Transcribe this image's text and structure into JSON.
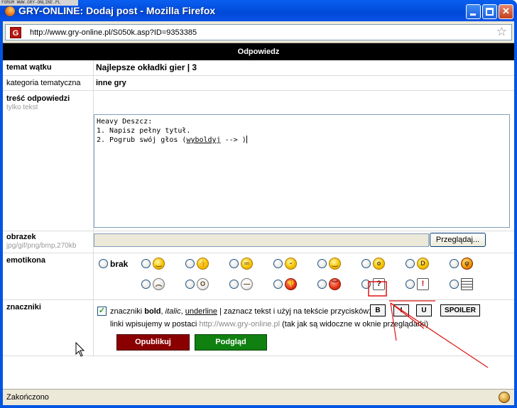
{
  "watermark": "FORUM WWW.GRY-ONLINE.PL",
  "window": {
    "title": "GRY-ONLINE: Dodaj post - Mozilla Firefox",
    "minimize_icon": "minimize-icon",
    "maximize_icon": "maximize-icon",
    "close_icon": "close-icon"
  },
  "address": {
    "site_icon_letter": "G",
    "url": "http://www.gry-online.pl/S050k.asp?ID=9353385"
  },
  "form": {
    "header": "Odpowiedz",
    "topic_label": "temat wątku",
    "topic_value": "Najlepsze okładki gier | 3",
    "category_label": "kategoria tematyczna",
    "category_value": "inne gry",
    "content_label": "treść odpowiedzi",
    "content_sublabel": "tylko tekst",
    "content_value_line1": "Heavy Deszcz:",
    "content_value_line2": "1. Napisz pełny tytuł.",
    "content_value_line3_prefix": "2. Pogrub swój głos (",
    "content_value_line3_link": "wyboldyj",
    "content_value_line3_suffix": " --> )",
    "image_label": "obrazek",
    "image_sublabel": "jpg/gif/png/bmp,270kb",
    "browse_button": "Przeglądaj...",
    "emoticons_label": "emotikona",
    "emoticon_none": "brak",
    "emoticon_question": "?",
    "emoticon_exclaim": "!",
    "tags_label": "znaczniki",
    "tags_text_prefix": "znaczniki ",
    "tags_bold": "bold",
    "tags_italic": "italic",
    "tags_underline": "underline",
    "tags_text_suffix": " | zaznacz tekst i użyj na tekście przycisków:",
    "tag_b": "B",
    "tag_i": "I",
    "tag_u": "U",
    "tag_spoiler": "SPOILER",
    "links_prefix": "linki wpisujemy w postaci ",
    "links_url": "http://www.gry-online.pl",
    "links_suffix": " (tak jak są widoczne w oknie przeglądarki)",
    "publish_button": "Opublikuj",
    "preview_button": "Podgląd"
  },
  "status": {
    "text": "Zakończono"
  },
  "colors": {
    "annotation": "#e01010",
    "publish": "#8a0000",
    "preview": "#108010"
  }
}
